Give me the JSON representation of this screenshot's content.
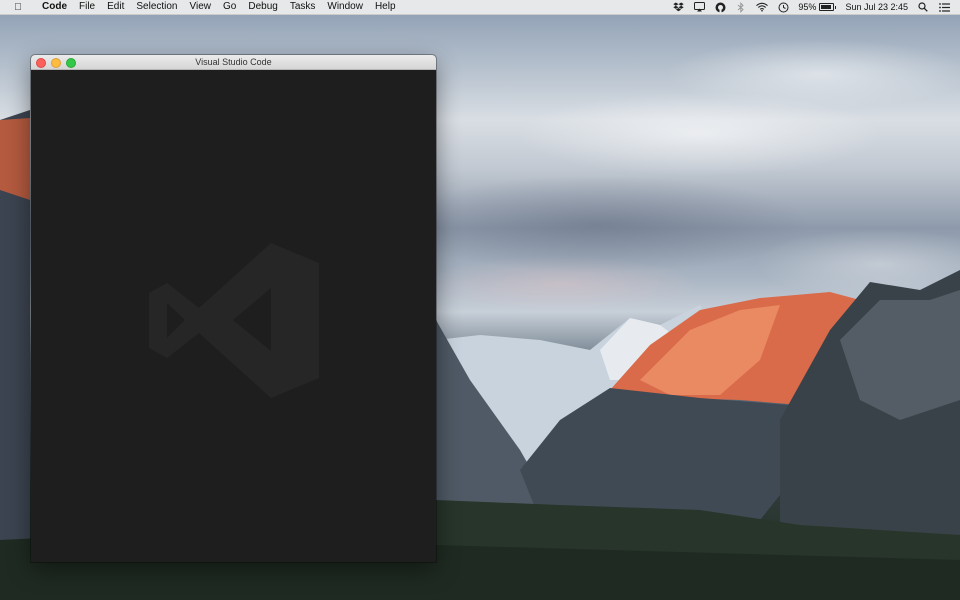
{
  "menubar": {
    "apple_glyph": "",
    "app_name": "Code",
    "menus": [
      "File",
      "Edit",
      "Selection",
      "View",
      "Go",
      "Debug",
      "Tasks",
      "Window",
      "Help"
    ],
    "status_icons": [
      "dropbox-icon",
      "airplay-icon",
      "sync-icon",
      "bluetooth-icon",
      "wifi-icon",
      "time-machine-icon"
    ],
    "battery_percent_text": "95%",
    "battery_level": 0.95,
    "clock": "Sun Jul 23  2:45",
    "search_icon": "search-icon",
    "list_icon": "notification-center-icon"
  },
  "window": {
    "title": "Visual Studio Code",
    "controls": [
      "close",
      "minimize",
      "maximize"
    ],
    "watermark_icon": "vscode-logo-watermark",
    "colors": {
      "editor_background": "#1e1e1e",
      "watermark": "#262626",
      "close": "#fc605b",
      "minimize": "#fdbc40",
      "maximize": "#34c84a"
    }
  },
  "desktop": {
    "wallpaper": "El Capitan mountain landscape"
  }
}
